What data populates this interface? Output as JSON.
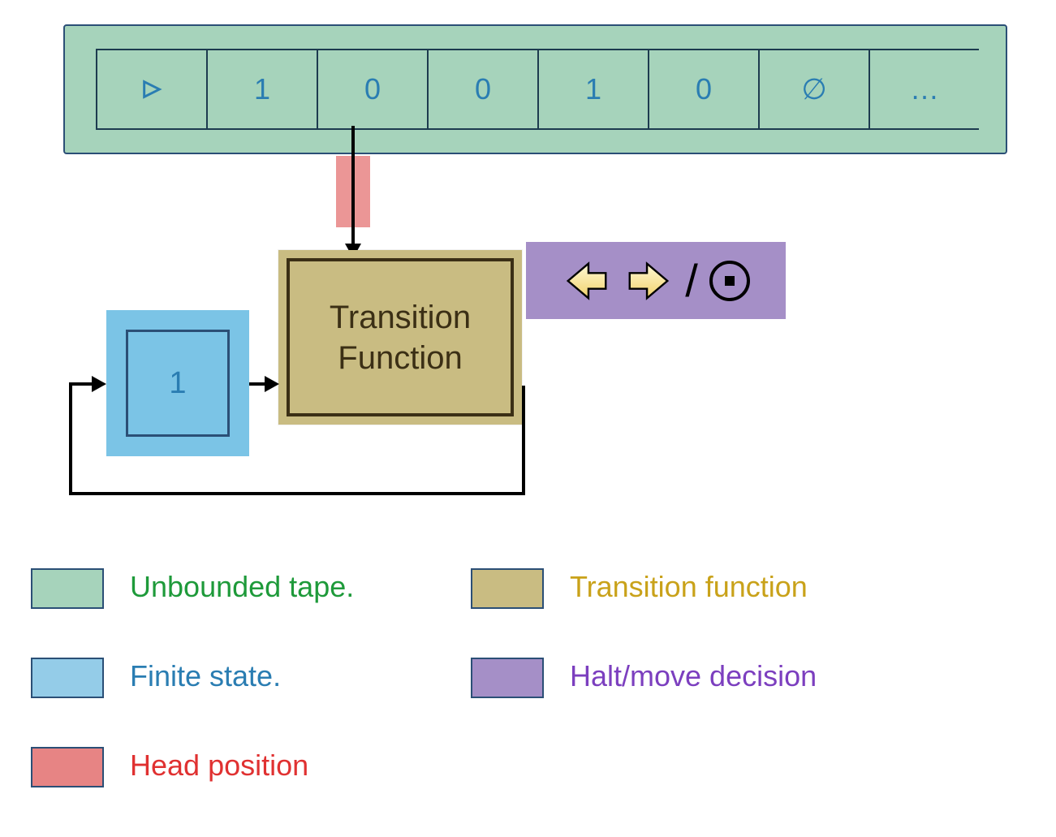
{
  "tape": {
    "cells": [
      "▷",
      "1",
      "0",
      "0",
      "1",
      "0",
      "∅",
      "…"
    ]
  },
  "head": {
    "name": "head-position"
  },
  "transition": {
    "label": "Transition\nFunction"
  },
  "halt": {
    "slash": "/"
  },
  "state": {
    "value": "1"
  },
  "legend": {
    "tape": "Unbounded tape.",
    "state": "Finite state.",
    "head": "Head position",
    "fn": "Transition function",
    "halt": "Halt/move decision"
  }
}
